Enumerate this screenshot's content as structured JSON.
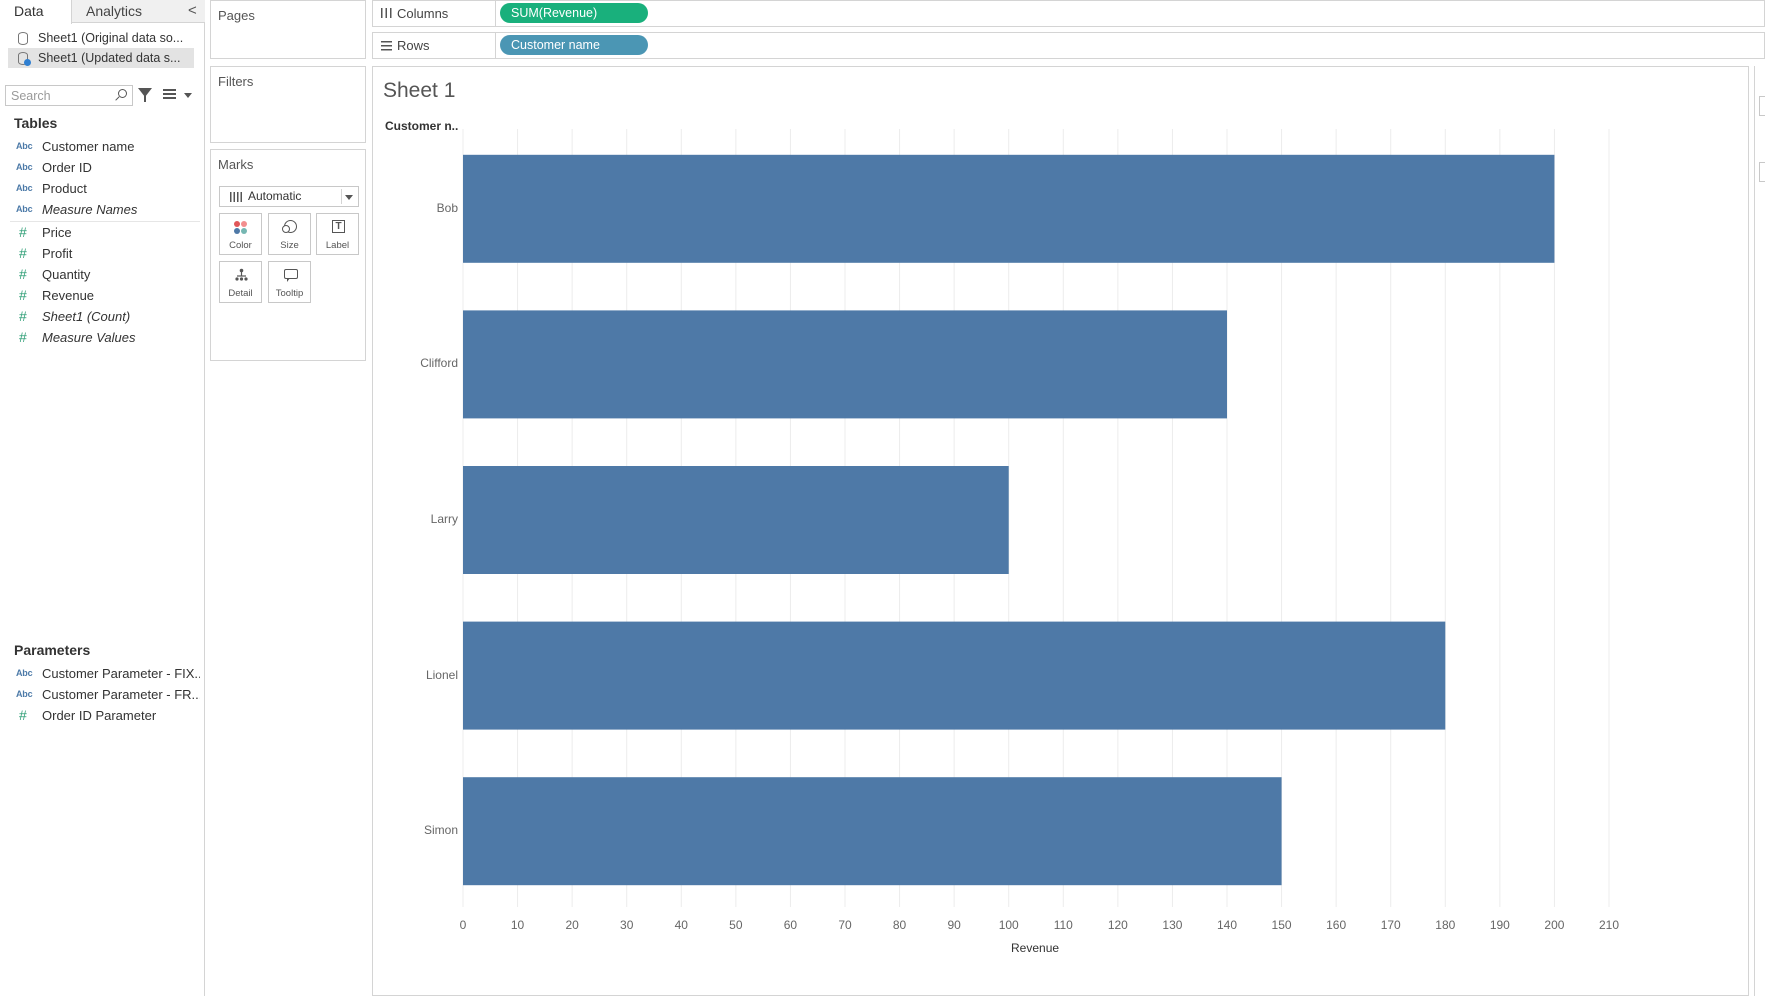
{
  "data_pane": {
    "tabs": [
      {
        "label": "Data",
        "active": true
      },
      {
        "label": "Analytics",
        "active": false
      }
    ],
    "collapse_glyph": "<",
    "data_sources": [
      {
        "label": "Sheet1 (Original data so...",
        "selected": false
      },
      {
        "label": "Sheet1 (Updated data s...",
        "selected": true
      }
    ],
    "search_placeholder": "Search",
    "tables_header": "Tables",
    "dimension_fields": [
      {
        "label": "Customer name",
        "type_label": "Abc",
        "italic": false
      },
      {
        "label": "Order ID",
        "type_label": "Abc",
        "italic": false
      },
      {
        "label": "Product",
        "type_label": "Abc",
        "italic": false
      },
      {
        "label": "Measure Names",
        "type_label": "Abc",
        "italic": true
      }
    ],
    "measure_fields": [
      {
        "label": "Price",
        "type_label": "#",
        "italic": false
      },
      {
        "label": "Profit",
        "type_label": "#",
        "italic": false
      },
      {
        "label": "Quantity",
        "type_label": "#",
        "italic": false
      },
      {
        "label": "Revenue",
        "type_label": "#",
        "italic": false
      },
      {
        "label": "Sheet1 (Count)",
        "type_label": "#",
        "italic": true
      },
      {
        "label": "Measure Values",
        "type_label": "#",
        "italic": true
      }
    ],
    "parameters_header": "Parameters",
    "parameters": [
      {
        "label": "Customer Parameter - FIX...",
        "type_label": "Abc"
      },
      {
        "label": "Customer Parameter - FR...",
        "type_label": "Abc"
      },
      {
        "label": "Order ID Parameter",
        "type_label": "#"
      }
    ]
  },
  "cards": {
    "pages": "Pages",
    "filters": "Filters",
    "marks": {
      "title": "Marks",
      "mark_type": "Automatic",
      "buttons": {
        "color": "Color",
        "size": "Size",
        "label": "Label",
        "detail": "Detail",
        "tooltip": "Tooltip"
      },
      "label_glyph": "T"
    }
  },
  "shelves": {
    "columns_label": "Columns",
    "columns_pill": "SUM(Revenue)",
    "rows_label": "Rows",
    "rows_pill": "Customer name"
  },
  "colors": {
    "bar": "#4e79a7",
    "measure_pill": "#19b07c",
    "dimension_pill": "#4b96b4",
    "color_dots": [
      "#e15759",
      "#f28e8e",
      "#4e79a7",
      "#76b7b2"
    ]
  },
  "view": {
    "sheet_title": "Sheet 1",
    "row_header": "Customer n.."
  },
  "chart_data": {
    "type": "bar",
    "orientation": "horizontal",
    "categories": [
      "Bob",
      "Clifford",
      "Larry",
      "Lionel",
      "Simon"
    ],
    "values": [
      200,
      140,
      100,
      180,
      150
    ],
    "xlabel": "Revenue",
    "ylabel": "Customer n..",
    "xlim": [
      0,
      210
    ],
    "x_ticks": [
      0,
      10,
      20,
      30,
      40,
      50,
      60,
      70,
      80,
      90,
      100,
      110,
      120,
      130,
      140,
      150,
      160,
      170,
      180,
      190,
      200,
      210
    ],
    "grid": true
  }
}
